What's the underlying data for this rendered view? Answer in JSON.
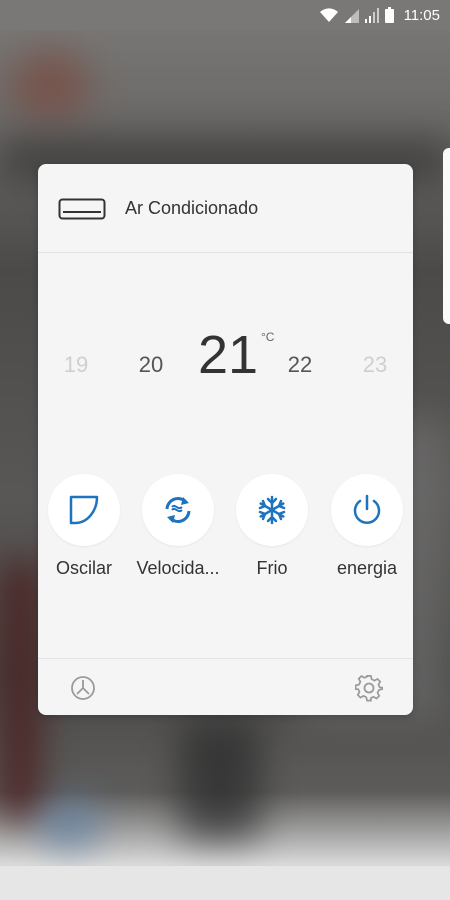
{
  "status_bar": {
    "time": "11:05"
  },
  "device": {
    "name": "Ar Condicionado"
  },
  "temperature": {
    "options": [
      "19",
      "20",
      "21",
      "22",
      "23"
    ],
    "current": "21",
    "unit": "°C"
  },
  "controls": [
    {
      "label": "Oscilar",
      "icon": "swing-icon"
    },
    {
      "label": "Velocida...",
      "icon": "fan-speed-icon"
    },
    {
      "label": "Frio",
      "icon": "snowflake-icon"
    },
    {
      "label": "energia",
      "icon": "power-icon"
    }
  ],
  "colors": {
    "accent": "#1e73be",
    "card": "#f5f5f5"
  }
}
